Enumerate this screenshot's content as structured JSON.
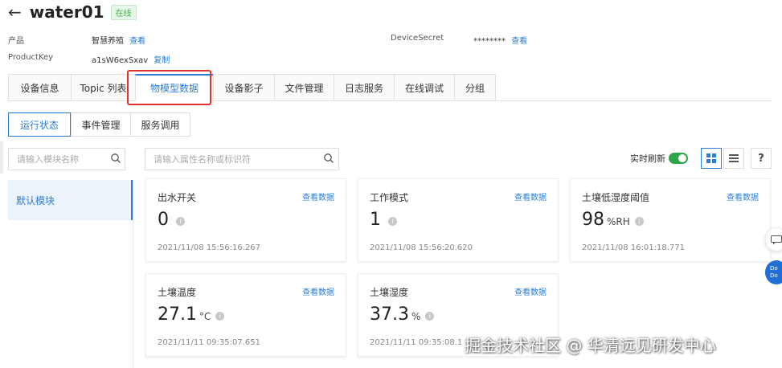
{
  "header": {
    "title": "water01",
    "status_badge": "在线"
  },
  "device_info": {
    "product_label": "产品",
    "product_value": "智慧养殖",
    "product_link": "查看",
    "productkey_label": "ProductKey",
    "productkey_value": "a1sW6exSxav",
    "productkey_link": "复制",
    "secret_label": "DeviceSecret",
    "secret_value": "********",
    "secret_link": "查看"
  },
  "tabs": [
    {
      "label": "设备信息"
    },
    {
      "label": "Topic 列表"
    },
    {
      "label": "物模型数据"
    },
    {
      "label": "设备影子"
    },
    {
      "label": "文件管理"
    },
    {
      "label": "日志服务"
    },
    {
      "label": "在线调试"
    },
    {
      "label": "分组"
    }
  ],
  "subtabs": [
    {
      "label": "运行状态"
    },
    {
      "label": "事件管理"
    },
    {
      "label": "服务调用"
    }
  ],
  "module_search": {
    "placeholder": "请输入模块名称"
  },
  "property_search": {
    "placeholder": "请输入属性名称或标识符"
  },
  "sidebar": {
    "items": [
      {
        "label": "默认模块"
      }
    ]
  },
  "toolbar": {
    "realtime_label": "实时刷新",
    "help": "?"
  },
  "cards": [
    {
      "title": "出水开关",
      "link": "查看数据",
      "value": "0",
      "unit": "",
      "time": "2021/11/08 15:56:16.267"
    },
    {
      "title": "工作模式",
      "link": "查看数据",
      "value": "1",
      "unit": "",
      "time": "2021/11/08 15:56:20.620"
    },
    {
      "title": "土壤低湿度阈值",
      "link": "查看数据",
      "value": "98",
      "unit": "%RH",
      "time": "2021/11/08 16:01:18.771"
    },
    {
      "title": "土壤温度",
      "link": "查看数据",
      "value": "27.1",
      "unit": "°C",
      "time": "2021/11/11 09:35:07.651"
    },
    {
      "title": "土壤湿度",
      "link": "查看数据",
      "value": "37.3",
      "unit": "%",
      "time": "2021/11/11 09:35:08.1"
    }
  ],
  "floating": {
    "help_text": "Do\nDo"
  },
  "watermark": "掘金技术社区 @ 华清远见研发中心",
  "colors": {
    "accent": "#2b7cd3",
    "online": "#3fae4a",
    "highlight": "#e0312f"
  }
}
